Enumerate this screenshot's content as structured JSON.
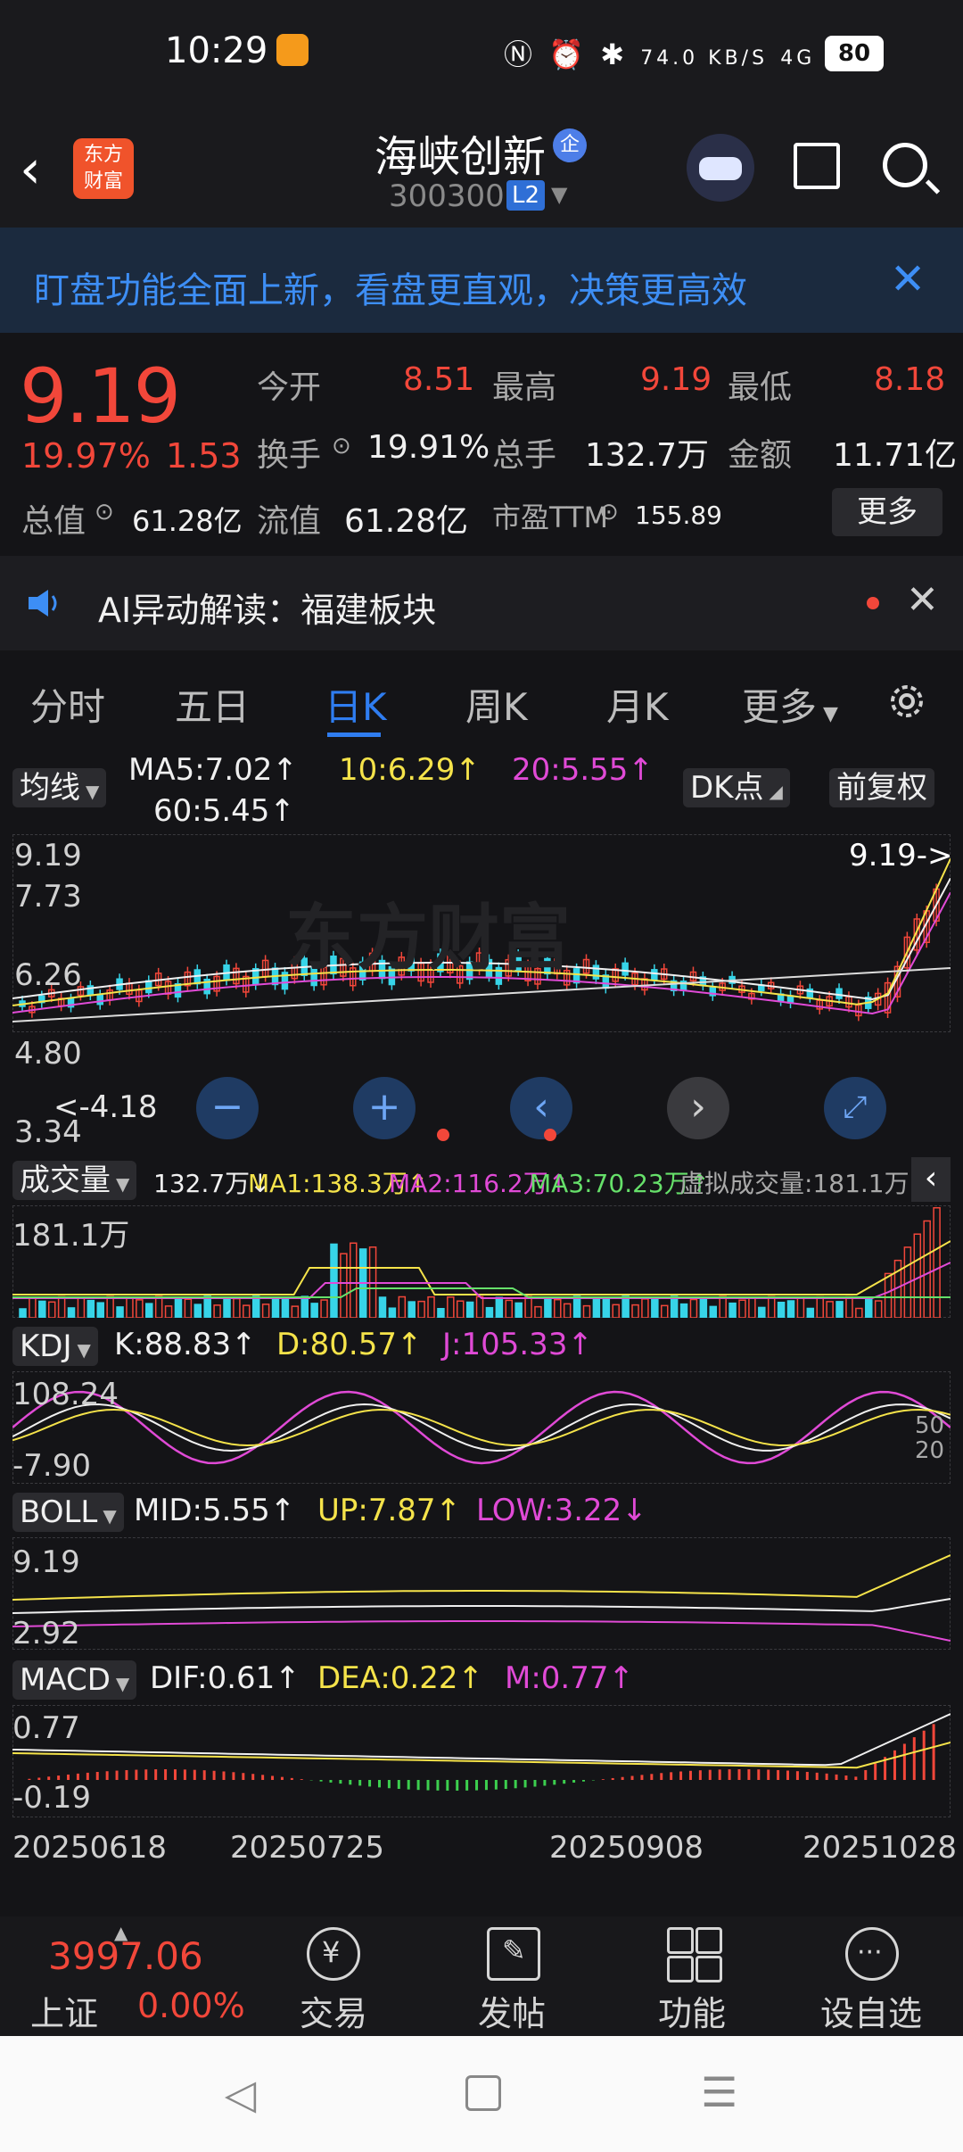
{
  "status_bar": {
    "time": "10:29",
    "net_speed": "74.0 KB/S",
    "signal": "4G 5G",
    "battery": "80"
  },
  "header": {
    "brand": "东方\n财富",
    "stock_name": "海峡创新",
    "stock_badge": "企",
    "stock_code": "300300",
    "level_badge": "L2"
  },
  "banner": {
    "text": "盯盘功能全面上新，看盘更直观，决策更高效"
  },
  "quote": {
    "price": "9.19",
    "change_pct": "19.97%",
    "change": "1.53",
    "open_label": "今开",
    "open": "8.51",
    "high_label": "最高",
    "high": "9.19",
    "low_label": "最低",
    "low": "8.18",
    "turnover_rate_label": "换手",
    "turnover_rate": "19.91%",
    "volume_label": "总手",
    "volume": "132.7万",
    "amount_label": "金额",
    "amount": "11.71亿",
    "total_cap_label": "总值",
    "total_cap": "61.28亿",
    "float_cap_label": "流值",
    "float_cap": "61.28亿",
    "pe_label": "市盈TTM",
    "pe": "155.89",
    "more_button": "更多"
  },
  "ai_bar": {
    "text": "AI异动解读：福建板块"
  },
  "tabs": [
    "分时",
    "五日",
    "日K",
    "周K",
    "月K",
    "更多"
  ],
  "active_tab": "日K",
  "main_chart": {
    "ma_button": "均线",
    "ma5": "MA5:7.02↑",
    "ma10": "10:6.29↑",
    "ma20": "20:5.55↑",
    "ma60": "60:5.45↑",
    "dk_button": "DK点",
    "adjust_button": "前复权",
    "y_labels": [
      "9.19",
      "7.73",
      "6.26",
      "4.80",
      "3.34"
    ],
    "last_price_tag": "9.19->",
    "low_tag": "4.18",
    "watermark": "东方财富"
  },
  "volume_panel": {
    "button": "成交量",
    "vol": "132.7万↓",
    "ma1": "MA1:138.3万↑",
    "ma2": "MA2:116.2万↑",
    "ma3": "MA3:70.23万↑",
    "virtual": "虚拟成交量:181.1万",
    "y_label": "181.1万"
  },
  "kdj_panel": {
    "button": "KDJ",
    "k": "K:88.83↑",
    "d": "D:80.57↑",
    "j": "J:105.33↑",
    "y_top": "108.24",
    "y_bottom": "-7.90",
    "r1": "50",
    "r2": "20"
  },
  "boll_panel": {
    "button": "BOLL",
    "mid": "MID:5.55↑",
    "up": "UP:7.87↑",
    "low": "LOW:3.22↓",
    "y_top": "9.19",
    "y_bottom": "2.92"
  },
  "macd_panel": {
    "button": "MACD",
    "dif": "DIF:0.61↑",
    "dea": "DEA:0.22↑",
    "m": "M:0.77↑",
    "y_top": "0.77",
    "y_bottom": "-0.19"
  },
  "dates": [
    "20250618",
    "20250725",
    "20250908",
    "20251028"
  ],
  "bottom_nav": {
    "index_value": "3997.06",
    "index_name": "上证",
    "index_change": "0.00%",
    "items": [
      "交易",
      "发帖",
      "功能",
      "设自选"
    ]
  },
  "colors": {
    "up": "#f2473a",
    "down": "#37d4e8",
    "ma5": "#f0f0f0",
    "ma10": "#f5e34a",
    "ma20": "#e04ad6",
    "accent": "#2f7df0"
  }
}
